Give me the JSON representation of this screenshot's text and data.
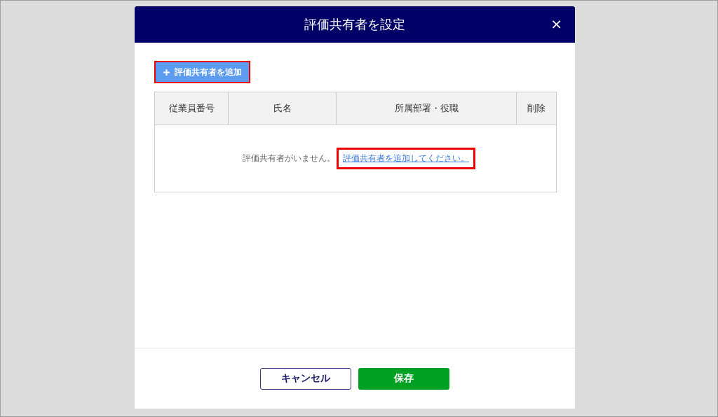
{
  "dialog": {
    "title": "評価共有者を設定",
    "close": "×"
  },
  "add_button": {
    "label": "評価共有者を追加",
    "highlighted": true
  },
  "table": {
    "columns": [
      "従業員番号",
      "氏名",
      "所属部署・役職",
      "削除"
    ],
    "empty_message": "評価共有者がいません。",
    "empty_link": {
      "label": "評価共有者を追加してください。",
      "highlighted": true
    }
  },
  "footer": {
    "buttons": [
      {
        "label": "キャンセル",
        "kind": "secondary"
      },
      {
        "label": "保存",
        "kind": "primary"
      }
    ]
  }
}
